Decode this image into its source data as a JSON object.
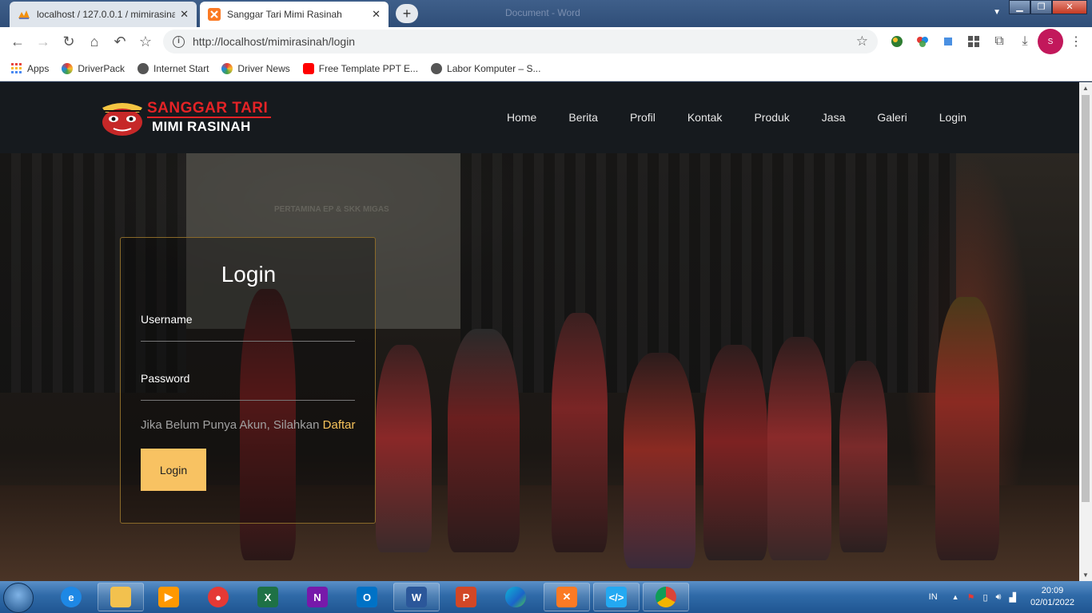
{
  "browser": {
    "tabs": [
      {
        "title": "localhost / 127.0.0.1 / mimirasinah",
        "active": false
      },
      {
        "title": "Sanggar Tari Mimi Rasinah",
        "active": true
      }
    ],
    "ghost_title": "Document - Word",
    "url": "http://localhost/mimirasinah/login",
    "profile_initial": "S",
    "bookmarks": [
      "Apps",
      "DriverPack",
      "Internet Start",
      "Driver News",
      "Free Template PPT E...",
      "Labor Komputer – S..."
    ]
  },
  "site": {
    "logo_line1": "SANGGAR TARI",
    "logo_line2": "MIMI RASINAH",
    "menu": [
      "Home",
      "Berita",
      "Profil",
      "Kontak",
      "Produk",
      "Jasa",
      "Galeri",
      "Login"
    ],
    "banner_text": "PERTAMINA EP & SKK MIGAS"
  },
  "login": {
    "title": "Login",
    "username_label": "Username",
    "password_label": "Password",
    "signup_text": "Jika Belum Punya Akun, Silahkan",
    "signup_link": "Daftar",
    "submit_label": "Login"
  },
  "taskbar": {
    "language": "IN",
    "time": "20:09",
    "date": "02/01/2022"
  },
  "colors": {
    "accent": "#f8c262",
    "logo_red": "#e42326",
    "nav_bg": "#161a1e"
  }
}
